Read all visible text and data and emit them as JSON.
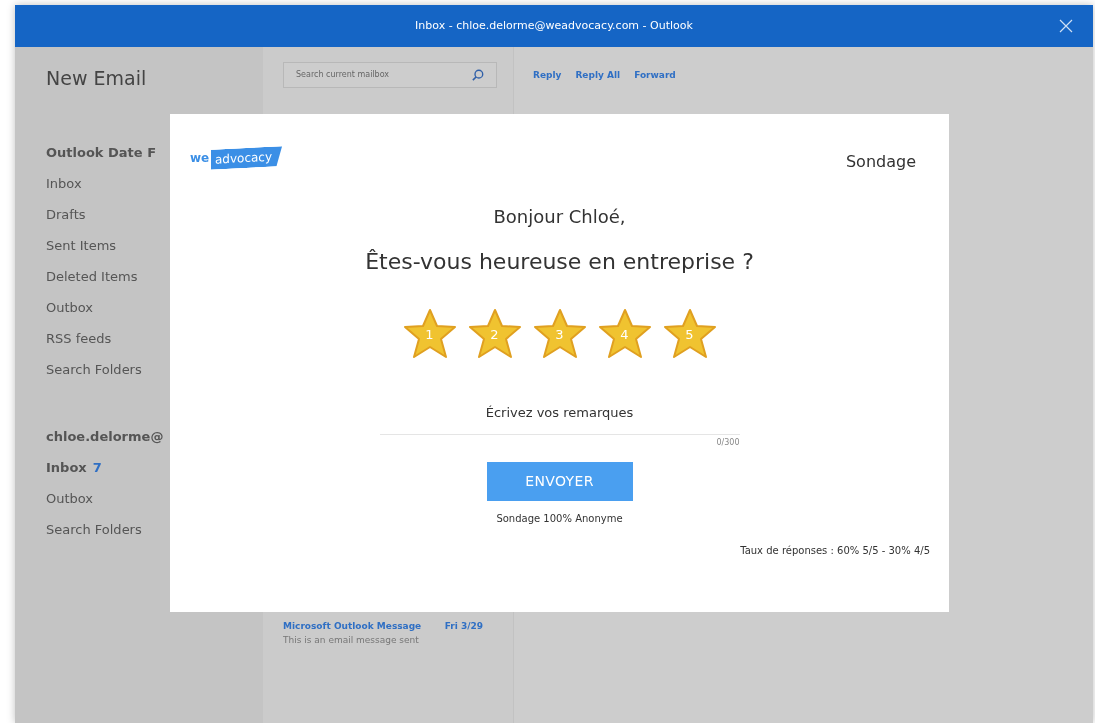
{
  "window": {
    "title": "Inbox - chloe.delorme@weadvocacy.com - Outlook"
  },
  "sidebar": {
    "new_email": "New Email",
    "sections": [
      {
        "title": "Outlook Date F",
        "items": [
          {
            "label": "Inbox"
          },
          {
            "label": "Drafts"
          },
          {
            "label": "Sent Items"
          },
          {
            "label": "Deleted Items"
          },
          {
            "label": "Outbox"
          },
          {
            "label": "RSS feeds"
          },
          {
            "label": "Search Folders"
          }
        ]
      },
      {
        "title": "chloe.delorme@",
        "items": [
          {
            "label": "Inbox",
            "count": "7"
          },
          {
            "label": "Outbox"
          },
          {
            "label": "Search Folders"
          }
        ]
      }
    ]
  },
  "message_list": {
    "search": {
      "placeholder": "Search current mailbox"
    },
    "messages": [
      {
        "subject": "Microsoft Outlook Message",
        "date": "Fri 3/29",
        "preview": "This is an email message sent"
      }
    ]
  },
  "reading_pane": {
    "actions": [
      "Reply",
      "Reply All",
      "Forward"
    ]
  },
  "survey": {
    "logo": {
      "part1": "we",
      "part2": "advocacy"
    },
    "label": "Sondage",
    "greeting": "Bonjour Chloé,",
    "question": "Êtes-vous heureuse en entreprise ?",
    "stars": 5,
    "star_labels": [
      "1",
      "2",
      "3",
      "4",
      "5"
    ],
    "comment": {
      "placeholder": "Écrivez vos remarques",
      "counter": "0/300"
    },
    "submit": "ENVOYER",
    "note": "Sondage 100% Anonyme",
    "stats": "Taux de réponses : 60% 5/5 - 30% 4/5"
  }
}
